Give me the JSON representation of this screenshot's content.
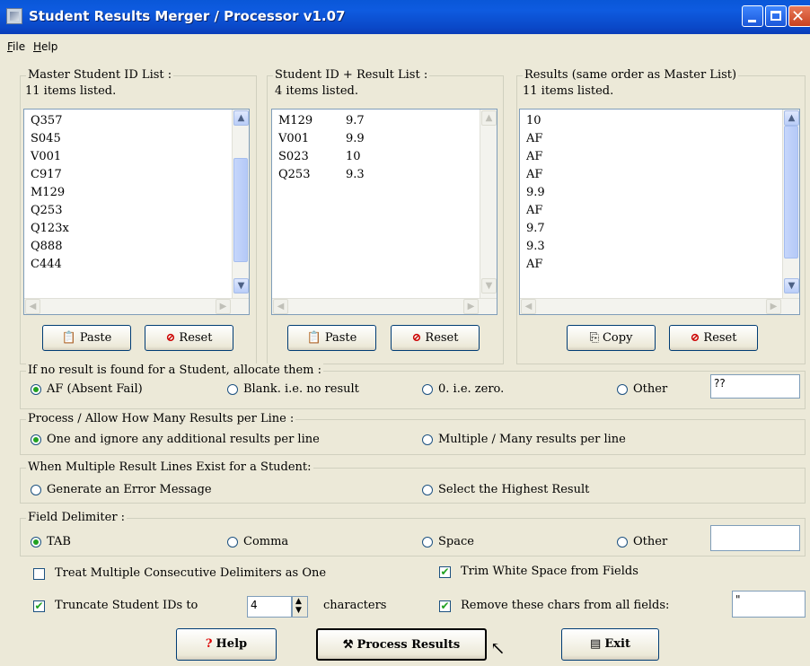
{
  "window": {
    "title": "Student Results Merger / Processor v1.07"
  },
  "menu": {
    "file": "File",
    "file_ul": "F",
    "file_rest": "ile",
    "help": "Help",
    "help_ul": "H",
    "help_rest": "elp"
  },
  "master": {
    "title": "Master Student ID List :",
    "count": "11 items listed.",
    "items": [
      "Q357",
      "S045",
      "V001",
      "C917",
      "M129",
      "Q253",
      "Q123x",
      "Q888",
      "C444"
    ],
    "paste": "Paste",
    "reset": "Reset"
  },
  "idresult": {
    "title": "Student ID + Result List :",
    "count": "4 items listed.",
    "rows": [
      {
        "id": "M129",
        "result": "9.7"
      },
      {
        "id": "V001",
        "result": "9.9"
      },
      {
        "id": "S023",
        "result": "10"
      },
      {
        "id": "Q253",
        "result": "9.3"
      }
    ],
    "paste": "Paste",
    "reset": "Reset"
  },
  "results": {
    "title": "Results (same order as Master List)",
    "count": "11 items listed.",
    "items": [
      "10",
      "AF",
      "AF",
      "AF",
      "9.9",
      "AF",
      "9.7",
      "9.3",
      "AF"
    ],
    "copy": "Copy",
    "reset": "Reset"
  },
  "noresult": {
    "title": "If no result is found for a Student, allocate them :",
    "opt_af": "AF (Absent Fail)",
    "opt_blank": "Blank. i.e. no result",
    "opt_zero": "0. i.e. zero.",
    "opt_other": "Other",
    "other_value": "??"
  },
  "perline": {
    "title": "Process / Allow How Many Results per Line :",
    "opt_one": "One and ignore any additional results per line",
    "opt_multi": "Multiple / Many results per line"
  },
  "multiple": {
    "title": "When Multiple Result Lines Exist for a Student:",
    "opt_error": "Generate an Error Message",
    "opt_highest": "Select the Highest Result"
  },
  "delim": {
    "title": "Field Delimiter :",
    "opt_tab": "TAB",
    "opt_comma": "Comma",
    "opt_space": "Space",
    "opt_other": "Other",
    "other_value": ""
  },
  "options": {
    "treat_multiple": "Treat Multiple Consecutive Delimiters as One",
    "trim": "Trim White Space from Fields",
    "truncate": "Truncate Student IDs to",
    "truncate_value": "4",
    "characters": "characters",
    "remove": "Remove these chars from all fields:",
    "remove_value": "\""
  },
  "buttons": {
    "help": "Help",
    "process": "Process Results",
    "exit": "Exit"
  },
  "colors": {
    "titlebar": "#0A57D8",
    "face": "#ECE9D8",
    "radio_dot": "#21A121"
  },
  "icons": [
    "app-icon",
    "paste-icon",
    "reset-icon",
    "copy-icon",
    "help-icon",
    "process-icon",
    "exit-icon",
    "cursor-icon"
  ]
}
